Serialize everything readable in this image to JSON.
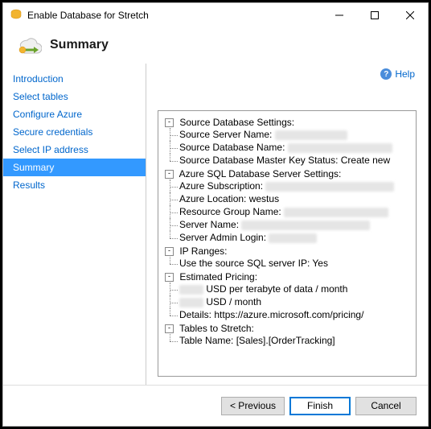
{
  "window": {
    "title": "Enable Database for Stretch"
  },
  "header": {
    "title": "Summary"
  },
  "sidebar": {
    "items": [
      "Introduction",
      "Select tables",
      "Configure Azure",
      "Secure credentials",
      "Select IP address",
      "Summary",
      "Results"
    ],
    "selected_index": 5
  },
  "main": {
    "help_label": "Help"
  },
  "summary": {
    "source_db": {
      "label": "Source Database Settings:",
      "server_label": "Source Server Name:",
      "dbname_label": "Source Database Name:",
      "masterkey": "Source Database Master Key Status: Create new"
    },
    "azure": {
      "label": "Azure SQL Database Server Settings:",
      "subscription_label": "Azure Subscription:",
      "location": "Azure Location: westus",
      "rg_label": "Resource Group Name:",
      "server_label": "Server Name:",
      "admin_label": "Server Admin Login:"
    },
    "ip": {
      "label": "IP Ranges:",
      "use_source": "Use the source SQL server IP: Yes"
    },
    "pricing": {
      "label": "Estimated Pricing:",
      "per_tb": "USD per terabyte of data / month",
      "per_month": "USD / month",
      "details": "Details: https://azure.microsoft.com/pricing/"
    },
    "tables": {
      "label": "Tables to Stretch:",
      "table1": "Table Name: [Sales].[OrderTracking]"
    }
  },
  "footer": {
    "previous": "< Previous",
    "finish": "Finish",
    "cancel": "Cancel"
  }
}
